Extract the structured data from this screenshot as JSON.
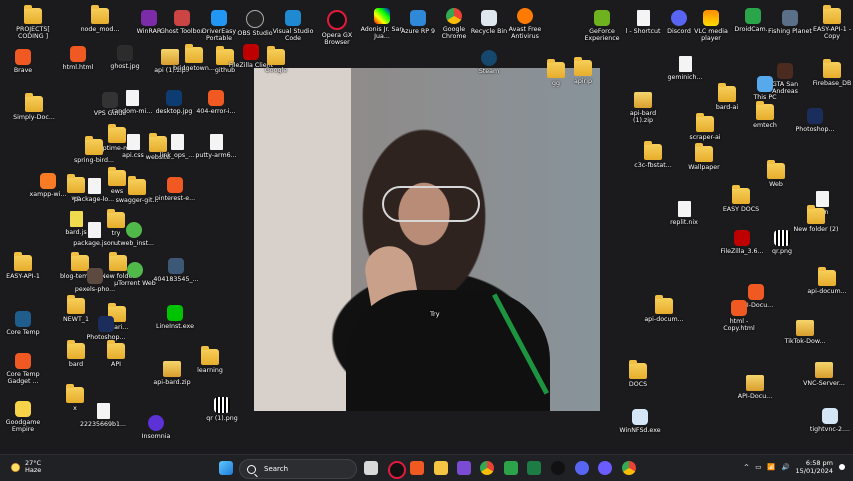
{
  "desktop": {
    "icons": [
      {
        "id": "projects-coding",
        "label": "PROJECTS[ CODING ]",
        "type": "folder"
      },
      {
        "id": "node-modules",
        "label": "node_mod...",
        "type": "folder"
      },
      {
        "id": "winrar",
        "label": "WinRAR",
        "type": "app"
      },
      {
        "id": "ghost-toolbox",
        "label": "Ghost Toolbox",
        "type": "app"
      },
      {
        "id": "drivereasy",
        "label": "DriverEasy Portable",
        "type": "app"
      },
      {
        "id": "obs",
        "label": "OBS Studio",
        "type": "app"
      },
      {
        "id": "vscode",
        "label": "Visual Studio Code",
        "type": "app"
      },
      {
        "id": "operagx",
        "label": "Opera GX Browser",
        "type": "app"
      },
      {
        "id": "adonis",
        "label": "Adonis Jr. San Jua...",
        "type": "app"
      },
      {
        "id": "azure",
        "label": "Azure RP 9",
        "type": "app"
      },
      {
        "id": "chrome",
        "label": "Google Chrome",
        "type": "app"
      },
      {
        "id": "recycle",
        "label": "Recycle Bin",
        "type": "app"
      },
      {
        "id": "avast",
        "label": "Avast Free Antivirus",
        "type": "app"
      },
      {
        "id": "geforce",
        "label": "GeForce Experience",
        "type": "app"
      },
      {
        "id": "shortcut",
        "label": "l - Shortcut",
        "type": "doc"
      },
      {
        "id": "discord",
        "label": "Discord",
        "type": "app"
      },
      {
        "id": "vlc",
        "label": "VLC media player",
        "type": "app"
      },
      {
        "id": "droidcam",
        "label": "DroidCam...",
        "type": "app"
      },
      {
        "id": "fishing",
        "label": "Fishing Planet",
        "type": "app"
      },
      {
        "id": "easyapi-copy",
        "label": "EASY-API-1 - Copy",
        "type": "folder"
      },
      {
        "id": "brave",
        "label": "Brave",
        "type": "app"
      },
      {
        "id": "html-html",
        "label": "html.html",
        "type": "doc"
      },
      {
        "id": "ghost-jpg",
        "label": "ghost.jpg",
        "type": "doc"
      },
      {
        "id": "api-1-zip",
        "label": "api (1).zip",
        "type": "zip"
      },
      {
        "id": "bridgetown-top",
        "label": "bridgetown...",
        "type": "folder"
      },
      {
        "id": "github",
        "label": "github",
        "type": "folder"
      },
      {
        "id": "filezilla-client",
        "label": "FileZilla Client",
        "type": "app"
      },
      {
        "id": "google-",
        "label": "Google",
        "type": "app"
      },
      {
        "id": "firebase-db",
        "label": "Firebase_DB",
        "type": "folder"
      },
      {
        "id": "gta",
        "label": "GTA San Andreas",
        "type": "app"
      },
      {
        "id": "simply-doc",
        "label": "Simply-Doc...",
        "type": "folder"
      },
      {
        "id": "vps-guide",
        "label": "VPS Guide",
        "type": "folder"
      },
      {
        "id": "random-mi",
        "label": "random-mi...",
        "type": "doc"
      },
      {
        "id": "desktop-jpg",
        "label": "desktop.jpg",
        "type": "doc"
      },
      {
        "id": "404-error",
        "label": "404-error-i...",
        "type": "app"
      },
      {
        "id": "api-bard-1-zip",
        "label": "api-bard (1).zip",
        "type": "zip"
      },
      {
        "id": "bard-ai",
        "label": "bard-ai",
        "type": "folder"
      },
      {
        "id": "this-pc",
        "label": "This PC",
        "type": "app"
      },
      {
        "id": "emtech",
        "label": "emtech",
        "type": "folder"
      },
      {
        "id": "photoshop-right",
        "label": "Photoshop...",
        "type": "app"
      },
      {
        "id": "uptime-m",
        "label": "uptime-m...",
        "type": "folder"
      },
      {
        "id": "spring-bird",
        "label": "spring-bird...",
        "type": "folder"
      },
      {
        "id": "api-css",
        "label": "api.css",
        "type": "doc"
      },
      {
        "id": "website",
        "label": "website",
        "type": "folder"
      },
      {
        "id": "link-ops",
        "label": "link_ops_...",
        "type": "doc"
      },
      {
        "id": "putty",
        "label": "putty-arm6...",
        "type": "doc"
      },
      {
        "id": "scraper-ai",
        "label": "scraper-ai",
        "type": "folder"
      },
      {
        "id": "c3c",
        "label": "c3c-fbstat...",
        "type": "folder"
      },
      {
        "id": "wallpaper",
        "label": "Wallpaper",
        "type": "folder"
      },
      {
        "id": "web",
        "label": "Web",
        "type": "folder"
      },
      {
        "id": "xampp",
        "label": "xampp-wi...",
        "type": "app"
      },
      {
        "id": "wp",
        "label": "wp",
        "type": "folder"
      },
      {
        "id": "package-lo",
        "label": "package-lo...",
        "type": "doc"
      },
      {
        "id": "ews",
        "label": "ews",
        "type": "folder"
      },
      {
        "id": "swagger",
        "label": "swagger-git...",
        "type": "folder"
      },
      {
        "id": "pinterest",
        "label": "pinterest-e...",
        "type": "app"
      },
      {
        "id": "easy-docs",
        "label": "EASY DOCS",
        "type": "folder"
      },
      {
        "id": "replit",
        "label": "replit.nix",
        "type": "doc"
      },
      {
        "id": "json",
        "label": "json",
        "type": "doc"
      },
      {
        "id": "bard-js",
        "label": "bard.js",
        "type": "doc"
      },
      {
        "id": "try",
        "label": "try",
        "type": "folder"
      },
      {
        "id": "package-json",
        "label": "package.json",
        "type": "doc"
      },
      {
        "id": "utweb",
        "label": "utweb_inst...",
        "type": "app"
      },
      {
        "id": "filezilla36",
        "label": "FileZilla_3.6...",
        "type": "app"
      },
      {
        "id": "qr-png",
        "label": "qr.png",
        "type": "doc"
      },
      {
        "id": "new-folder-2",
        "label": "New folder (2)",
        "type": "folder"
      },
      {
        "id": "easy-api-1",
        "label": "EASY-API-1",
        "type": "folder"
      },
      {
        "id": "blog-temp",
        "label": "blog-templ...",
        "type": "folder"
      },
      {
        "id": "new-folder",
        "label": "New folder",
        "type": "folder"
      },
      {
        "id": "utorrent",
        "label": "µTorrent Web",
        "type": "app"
      },
      {
        "id": "404183545",
        "label": "404183545_...",
        "type": "doc"
      },
      {
        "id": "api-docum-r",
        "label": "api-docum...",
        "type": "folder"
      },
      {
        "id": "pexels",
        "label": "pexels-pho...",
        "type": "doc"
      },
      {
        "id": "newt",
        "label": "NEWT_1",
        "type": "folder"
      },
      {
        "id": "mari",
        "label": "-mari...",
        "type": "folder"
      },
      {
        "id": "photoshop-left",
        "label": "Photoshop...",
        "type": "app"
      },
      {
        "id": "lineinst",
        "label": "LineInst.exe",
        "type": "app"
      },
      {
        "id": "api-docum-mid",
        "label": "api-docum...",
        "type": "folder"
      },
      {
        "id": "api-docu-2",
        "label": "API-Docu...",
        "type": "app"
      },
      {
        "id": "html-copy",
        "label": "html - Copy.html",
        "type": "app"
      },
      {
        "id": "tiktok",
        "label": "TikTok-Dow...",
        "type": "zip"
      },
      {
        "id": "core-temp",
        "label": "Core Temp",
        "type": "app"
      },
      {
        "id": "bard",
        "label": "bard",
        "type": "folder"
      },
      {
        "id": "api",
        "label": "API",
        "type": "folder"
      },
      {
        "id": "api-bard-zip",
        "label": "api-bard.zip",
        "type": "zip"
      },
      {
        "id": "learning",
        "label": "learning",
        "type": "folder"
      },
      {
        "id": "docs",
        "label": "DOCS",
        "type": "folder"
      },
      {
        "id": "core-temp-gadget",
        "label": "Core Temp Gadget ...",
        "type": "app"
      },
      {
        "id": "api-docu-3",
        "label": "API-Docu...",
        "type": "zip"
      },
      {
        "id": "vnc",
        "label": "VNC-Server...",
        "type": "zip"
      },
      {
        "id": "x",
        "label": "x",
        "type": "folder"
      },
      {
        "id": "2223",
        "label": "22235669b1...",
        "type": "doc"
      },
      {
        "id": "qr-1",
        "label": "qr (1).png",
        "type": "doc"
      },
      {
        "id": "goodgame",
        "label": "Goodgame Empire",
        "type": "app"
      },
      {
        "id": "insomnia",
        "label": "Insomnia",
        "type": "app"
      },
      {
        "id": "winnfsd",
        "label": "WinNFSd.exe",
        "type": "app"
      },
      {
        "id": "tightvnc",
        "label": "tightvnc-2....",
        "type": "app"
      },
      {
        "id": "steam",
        "label": "Steam",
        "type": "app"
      },
      {
        "id": "apirip",
        "label": "apirip",
        "type": "folder"
      },
      {
        "id": "gg",
        "label": "gg",
        "type": "folder"
      },
      {
        "id": "geminich",
        "label": "geminich...",
        "type": "doc"
      }
    ],
    "photo": {
      "overlay_label": "Try"
    }
  },
  "taskbar": {
    "weather": {
      "temp": "27°C",
      "condition": "Haze"
    },
    "search": {
      "placeholder": "Search"
    },
    "clock": {
      "time": "6:58 pm",
      "date": "15/01/2024"
    },
    "tray": {
      "chevron": "^"
    }
  }
}
